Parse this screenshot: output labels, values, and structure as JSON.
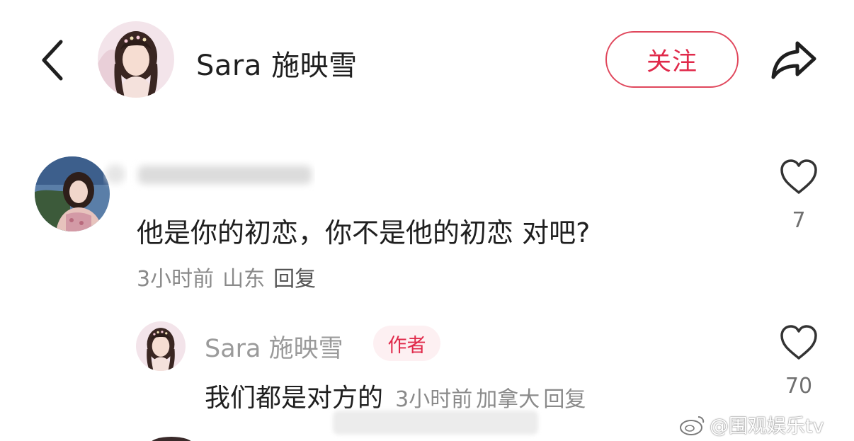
{
  "header": {
    "back_icon": "chevron-left-icon",
    "author_name": "Sara 施映雪",
    "follow_label": "关注",
    "share_icon": "share-arrow-icon",
    "accent_color": "#e0294a"
  },
  "comment": {
    "text": "他是你的初恋，你不是他的初恋 对吧?",
    "time": "3小时前",
    "location": "山东",
    "reply_label": "回复",
    "likes": "7"
  },
  "reply": {
    "author_name": "Sara 施映雪",
    "author_badge": "作者",
    "text": "我们都是对方的",
    "time": "3小时前",
    "location": "加拿大",
    "reply_label": "回复",
    "likes": "70"
  },
  "watermark": {
    "text": "@围观娱乐tv"
  }
}
